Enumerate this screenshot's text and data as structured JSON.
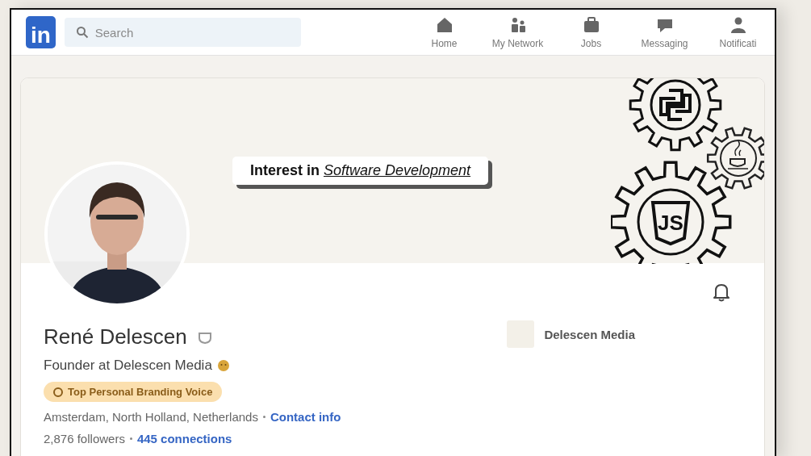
{
  "nav": {
    "logo": "in",
    "search": {
      "placeholder": "Search"
    },
    "items": [
      {
        "label": "Home",
        "kind": "home"
      },
      {
        "label": "My Network",
        "kind": "network"
      },
      {
        "label": "Jobs",
        "kind": "jobs"
      },
      {
        "label": "Messaging",
        "kind": "messaging"
      },
      {
        "label": "Notificati",
        "kind": "person"
      }
    ]
  },
  "banner": {
    "tagline": "**Interest in** *Software Development*",
    "shield_text": "JS"
  },
  "profile": {
    "name": "René Delescen",
    "headline": "Founder at Delescen Media",
    "badge": "Top Personal Branding Voice",
    "location": "Amsterdam, North Holland, Netherlands",
    "contact_link": "Contact info",
    "followers": "2,876 followers",
    "connections": "445 connections",
    "company": "Delescen Media"
  }
}
